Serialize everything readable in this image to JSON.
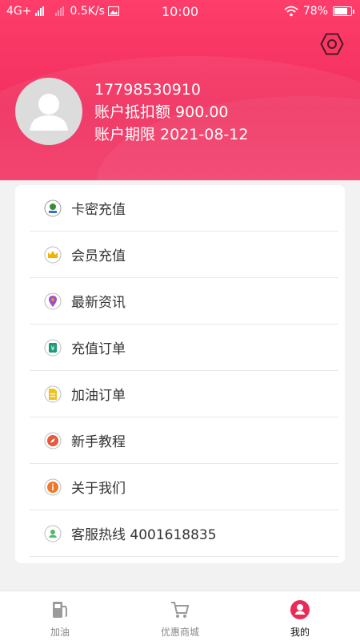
{
  "status_bar": {
    "network": "4G+",
    "speed": "0.5K/s",
    "time": "10:00",
    "battery": "78%",
    "battery_level": 0.78
  },
  "header": {
    "settings_icon": "hexagon-gear-icon",
    "accent_color": "#f0305f"
  },
  "profile": {
    "phone": "17798530910",
    "deduction_label": "账户抵扣额 900.00",
    "expiry_label": "账户期限 2021-08-12"
  },
  "menu": {
    "items": [
      {
        "label": "卡密充值",
        "icon": "card-recharge-icon"
      },
      {
        "label": "会员充值",
        "icon": "crown-icon"
      },
      {
        "label": "最新资讯",
        "icon": "location-pin-icon"
      },
      {
        "label": "充值订单",
        "icon": "yen-order-icon"
      },
      {
        "label": "加油订单",
        "icon": "document-icon"
      },
      {
        "label": "新手教程",
        "icon": "compass-icon"
      },
      {
        "label": "关于我们",
        "icon": "info-icon"
      },
      {
        "label": "客服热线 4001618835",
        "icon": "user-support-icon"
      }
    ]
  },
  "tabbar": {
    "tabs": [
      {
        "label": "加油",
        "icon": "fuel-pump-icon",
        "active": false
      },
      {
        "label": "优惠商城",
        "icon": "shopping-cart-icon",
        "active": false
      },
      {
        "label": "我的",
        "icon": "user-profile-icon",
        "active": true
      }
    ]
  }
}
